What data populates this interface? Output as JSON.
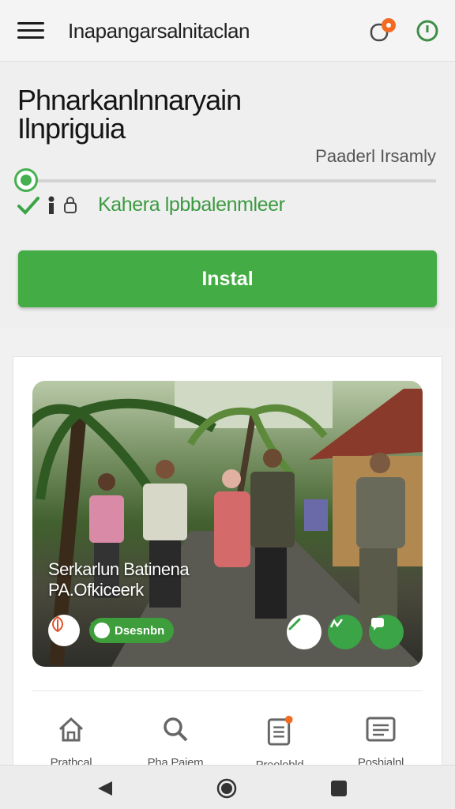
{
  "appbar": {
    "title": "Inapangarsalnitaclan",
    "icons": [
      "menu-icon",
      "notification-icon",
      "timer-icon"
    ],
    "notification_color": "#f26b21"
  },
  "header": {
    "app_name": "Phnarkanlnnaryain Ilnpriguia",
    "publisher": "Paaderl Irsamly",
    "meta_text": "Kahera lpbbalenmleer",
    "progress": 0.02,
    "install_label": "Instal",
    "accent": "#43ac44"
  },
  "card": {
    "photo_caption_line1": "Serkarlun Batinena",
    "photo_caption_line2": "PA.Ofkiceerk",
    "chip_label": "Dsesnbn"
  },
  "bottom_nav": [
    {
      "label": "Prathcal",
      "icon": "home-icon"
    },
    {
      "label": "Pha Pajem",
      "icon": "search-icon"
    },
    {
      "label": "Preolobld",
      "icon": "clipboard-icon"
    },
    {
      "label": "Poshialnl",
      "icon": "library-icon"
    }
  ],
  "system_nav": [
    "back-icon",
    "home-circle-icon",
    "recents-icon"
  ]
}
